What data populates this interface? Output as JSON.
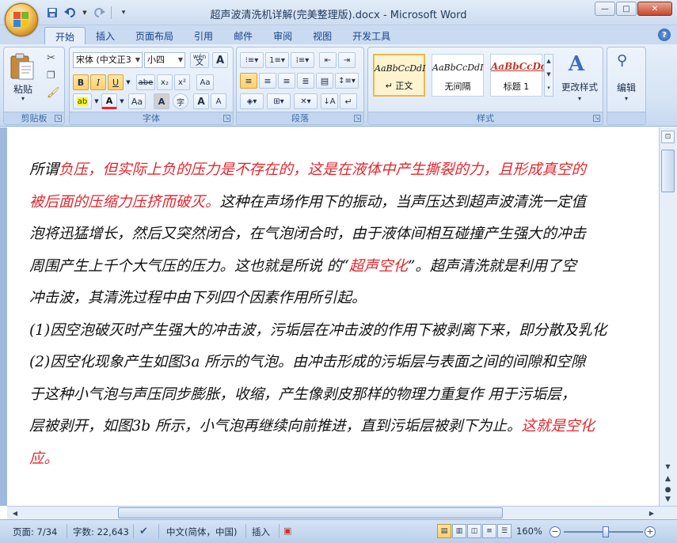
{
  "window": {
    "title": "超声波清洗机详解(完美整理版).docx - Microsoft Word",
    "controls": {
      "minimize": "—",
      "maximize": "□",
      "close": "✕"
    }
  },
  "quick_access": {
    "save_icon": "save-icon",
    "undo_icon": "undo-icon",
    "redo_icon": "redo-icon",
    "customize_icon": "customize-icon"
  },
  "tabs": [
    {
      "label": "开始",
      "active": true
    },
    {
      "label": "插入"
    },
    {
      "label": "页面布局"
    },
    {
      "label": "引用"
    },
    {
      "label": "邮件"
    },
    {
      "label": "审阅"
    },
    {
      "label": "视图"
    },
    {
      "label": "开发工具"
    }
  ],
  "ribbon": {
    "clipboard": {
      "label": "剪贴板",
      "paste": "粘贴"
    },
    "font": {
      "label": "字体",
      "font_name": "宋体 (中文正3",
      "font_size": "小四",
      "wen_label": "wén",
      "a_box": "A",
      "bold": "B",
      "italic": "I",
      "underline": "U",
      "strike": "abe",
      "subscript": "x₂",
      "superscript": "x²",
      "change_case": "Aa",
      "grow": "A",
      "shrink": "A",
      "clear": "Aa",
      "char_shading": "A",
      "enclose": "字"
    },
    "paragraph": {
      "label": "段落"
    },
    "styles": {
      "label": "样式",
      "items": [
        {
          "sample": "AaBbCcDdI",
          "name": "↵ 正文",
          "selected": true
        },
        {
          "sample": "AaBbCcDdI",
          "name": "无间隔"
        },
        {
          "sample": "AaBbCcDd",
          "name": "标题 1"
        }
      ],
      "change_styles": "更改样式"
    },
    "editing": {
      "label": "编辑"
    }
  },
  "document": {
    "lines": [
      {
        "segments": [
          {
            "text": "所谓",
            "red": false
          },
          {
            "text": "负压，但实际上负的压力是不存在的，这是在液体中产生撕裂的力，且形成真空的",
            "red": true
          }
        ]
      },
      {
        "segments": [
          {
            "text": "被后面的压缩力压挤而破灭。",
            "red": true
          },
          {
            "text": "这种在声场作用下的振动，当声压达到超声波清洗一定值",
            "red": false
          }
        ]
      },
      {
        "segments": [
          {
            "text": "泡将迅猛增长，然后又突然闭合，在气泡闭合时，由于液体间相互碰撞产生强大的冲击",
            "red": false
          }
        ]
      },
      {
        "segments": [
          {
            "text": "周围产生上千个大气压的压力。这也就是所说 的“",
            "red": false
          },
          {
            "text": "超声空化",
            "red": true
          },
          {
            "text": "”。超声清洗就是利用了空",
            "red": false
          }
        ]
      },
      {
        "segments": [
          {
            "text": "冲击波，其清洗过程中由下列四个因素作用所引起。",
            "red": false
          }
        ]
      },
      {
        "segments": [
          {
            "text": "(1)因空泡破灭时产生强大的冲击波，污垢层在冲击波的作用下被剥离下来，即分散及乳化",
            "red": false
          }
        ]
      },
      {
        "segments": [
          {
            "text": "(2)因空化现象产生如图3a 所示的气泡。由冲击形成的污垢层与表面之间的间隙和空隙",
            "red": false
          }
        ]
      },
      {
        "segments": [
          {
            "text": "于这种小气泡与声压同步膨胀，收缩，产生像剥皮那样的物理力重复作  用于污垢层，",
            "red": false
          }
        ]
      },
      {
        "segments": [
          {
            "text": "层被剥开，如图3b 所示，小气泡再继续向前推进，直到污垢层被剥下为止。",
            "red": false
          },
          {
            "text": "这就是空化",
            "red": true
          }
        ]
      },
      {
        "segments": [
          {
            "text": "应。",
            "red": true
          }
        ]
      }
    ]
  },
  "status": {
    "page": "页面: 7/34",
    "words": "字数: 22,643",
    "language": "中文(简体，中国)",
    "mode": "插入",
    "zoom": "160%",
    "zoom_value": 160
  },
  "colors": {
    "accent": "#15428b",
    "red_text": "#e4252d"
  }
}
